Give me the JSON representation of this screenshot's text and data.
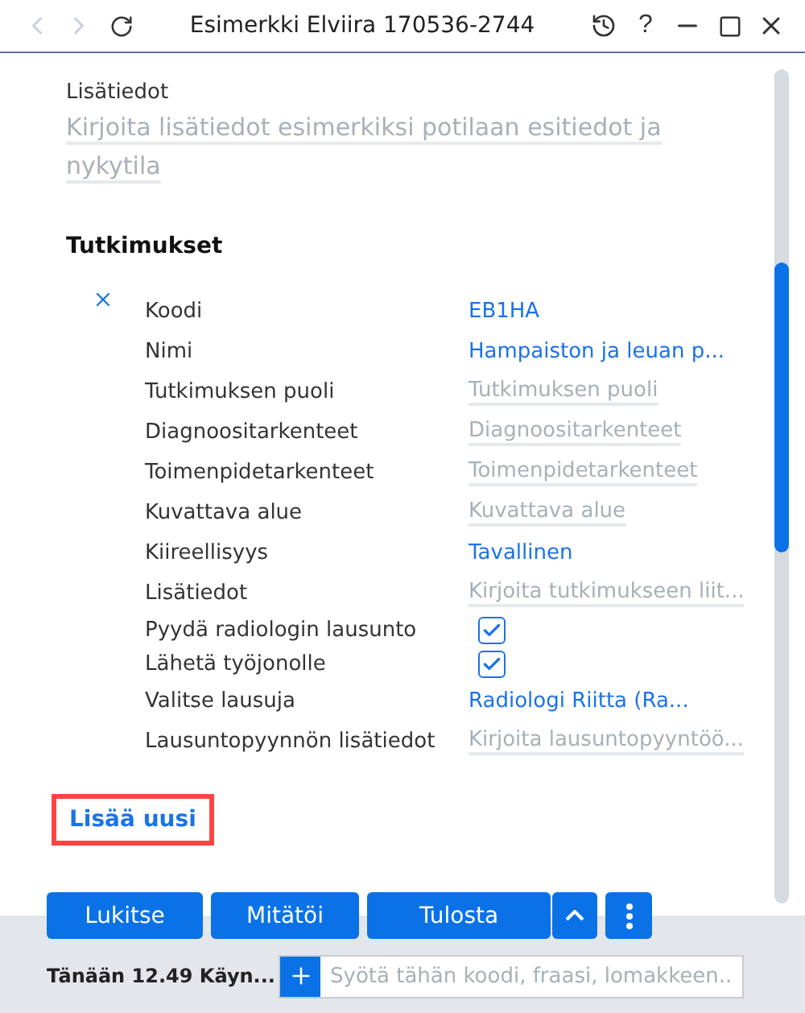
{
  "window": {
    "title": "Esimerkki Elviira 170536-2744",
    "help": "?"
  },
  "notes": {
    "label": "Lisätiedot",
    "placeholder": "Kirjoita lisätiedot esimerkiksi potilaan esitiedot ja nykytila"
  },
  "section": {
    "title": "Tutkimukset"
  },
  "fields": [
    {
      "label": "Koodi",
      "kind": "value",
      "value": "EB1HA"
    },
    {
      "label": "Nimi",
      "kind": "value",
      "value": "Hampaiston ja leuan p..."
    },
    {
      "label": "Tutkimuksen puoli",
      "kind": "input",
      "placeholder": "Tutkimuksen puoli"
    },
    {
      "label": "Diagnoositarkenteet",
      "kind": "input",
      "placeholder": "Diagnoositarkenteet"
    },
    {
      "label": "Toimenpidetarkenteet",
      "kind": "input",
      "placeholder": "Toimenpidetarkenteet"
    },
    {
      "label": "Kuvattava alue",
      "kind": "input",
      "placeholder": "Kuvattava alue"
    },
    {
      "label": "Kiireellisyys",
      "kind": "value",
      "value": "Tavallinen"
    },
    {
      "label": "Lisätiedot",
      "kind": "input",
      "placeholder": "Kirjoita tutkimukseen liit..."
    },
    {
      "label": "Pyydä radiologin lausunto",
      "kind": "checkbox",
      "checked": true
    },
    {
      "label": "Lähetä työjonolle",
      "kind": "checkbox",
      "checked": true
    },
    {
      "label": "Valitse lausuja",
      "kind": "value",
      "value": "Radiologi Riitta (Ra..."
    },
    {
      "label": "Lausuntopyynnön lisätiedot",
      "kind": "input",
      "placeholder": "Kirjoita lausuntopyyntöö..."
    }
  ],
  "add_link": {
    "label": "Lisää uusi",
    "highlighted": true
  },
  "buttons": [
    "Lukitse",
    "Mitätöi",
    "Tulosta"
  ],
  "status_bar": {
    "text": "Tänään 12.49 Käyn...",
    "placeholder": "Syötä tähän koodi, fraasi, lomakkeen..."
  }
}
